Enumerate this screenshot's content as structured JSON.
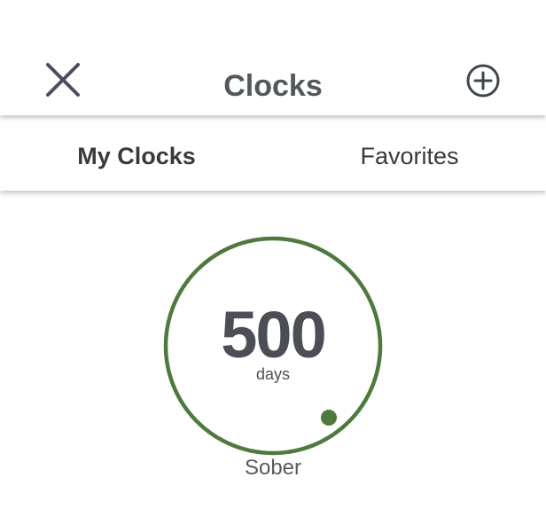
{
  "header": {
    "title": "Clocks",
    "close_icon": "close-icon",
    "add_icon": "plus-circle-icon"
  },
  "tabs": [
    {
      "label": "My Clocks",
      "active": true
    },
    {
      "label": "Favorites",
      "active": false
    }
  ],
  "clock": {
    "value": "500",
    "unit": "days",
    "label": "Sober",
    "ring_color": "#4e7a3e"
  },
  "colors": {
    "text": "#4b4f55",
    "ring": "#4e7a3e",
    "background": "#ffffff"
  }
}
